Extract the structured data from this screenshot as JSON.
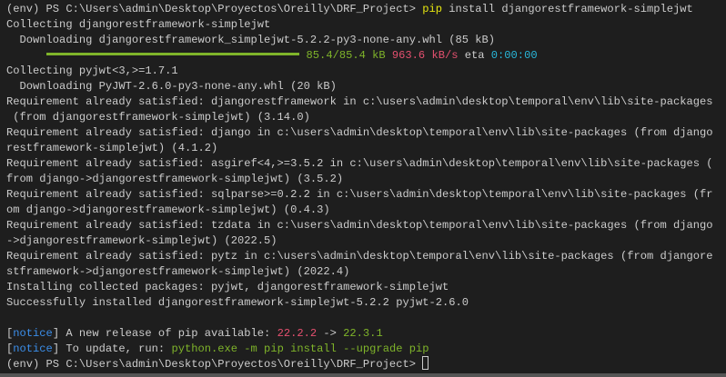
{
  "terminal": {
    "lines": [
      [
        {
          "t": "(env) PS C:\\Users\\admin\\Desktop\\Proyectos\\Oreilly\\DRF_Project> ",
          "c": "default"
        },
        {
          "t": "pip",
          "c": "yellow"
        },
        {
          "t": " install djangorestframework-simplejwt",
          "c": "default"
        }
      ],
      [
        {
          "t": "Collecting djangorestframework-simplejwt",
          "c": "default"
        }
      ],
      [
        {
          "t": "  Downloading djangorestframework_simplejwt-5.2.2-py3-none-any.whl (85 kB)",
          "c": "default"
        }
      ],
      [
        {
          "t": "      ",
          "c": "default"
        },
        {
          "t": "",
          "c": "bar"
        },
        {
          "t": "85.4/85.4 kB",
          "c": "green"
        },
        {
          "t": " ",
          "c": "default"
        },
        {
          "t": "963.6 kB/s",
          "c": "red"
        },
        {
          "t": " eta ",
          "c": "default"
        },
        {
          "t": "0:00:00",
          "c": "cyan"
        }
      ],
      [
        {
          "t": "Collecting pyjwt<3,>=1.7.1",
          "c": "default"
        }
      ],
      [
        {
          "t": "  Downloading PyJWT-2.6.0-py3-none-any.whl (20 kB)",
          "c": "default"
        }
      ],
      [
        {
          "t": "Requirement already satisfied: djangorestframework in c:\\users\\admin\\desktop\\temporal\\env\\lib\\site-packages",
          "c": "default"
        }
      ],
      [
        {
          "t": " (from djangorestframework-simplejwt) (3.14.0)",
          "c": "default"
        }
      ],
      [
        {
          "t": "Requirement already satisfied: django in c:\\users\\admin\\desktop\\temporal\\env\\lib\\site-packages (from django",
          "c": "default"
        }
      ],
      [
        {
          "t": "restframework-simplejwt) (4.1.2)",
          "c": "default"
        }
      ],
      [
        {
          "t": "Requirement already satisfied: asgiref<4,>=3.5.2 in c:\\users\\admin\\desktop\\temporal\\env\\lib\\site-packages (",
          "c": "default"
        }
      ],
      [
        {
          "t": "from django->djangorestframework-simplejwt) (3.5.2)",
          "c": "default"
        }
      ],
      [
        {
          "t": "Requirement already satisfied: sqlparse>=0.2.2 in c:\\users\\admin\\desktop\\temporal\\env\\lib\\site-packages (fr",
          "c": "default"
        }
      ],
      [
        {
          "t": "om django->djangorestframework-simplejwt) (0.4.3)",
          "c": "default"
        }
      ],
      [
        {
          "t": "Requirement already satisfied: tzdata in c:\\users\\admin\\desktop\\temporal\\env\\lib\\site-packages (from django",
          "c": "default"
        }
      ],
      [
        {
          "t": "->djangorestframework-simplejwt) (2022.5)",
          "c": "default"
        }
      ],
      [
        {
          "t": "Requirement already satisfied: pytz in c:\\users\\admin\\desktop\\temporal\\env\\lib\\site-packages (from djangore",
          "c": "default"
        }
      ],
      [
        {
          "t": "stframework->djangorestframework-simplejwt) (2022.4)",
          "c": "default"
        }
      ],
      [
        {
          "t": "Installing collected packages: pyjwt, djangorestframework-simplejwt",
          "c": "default"
        }
      ],
      [
        {
          "t": "Successfully installed djangorestframework-simplejwt-5.2.2 pyjwt-2.6.0",
          "c": "default"
        }
      ],
      [
        {
          "t": "",
          "c": "default"
        }
      ],
      [
        {
          "t": "[",
          "c": "default"
        },
        {
          "t": "notice",
          "c": "blue"
        },
        {
          "t": "] A new release of pip available: ",
          "c": "default"
        },
        {
          "t": "22.2.2",
          "c": "red"
        },
        {
          "t": " -> ",
          "c": "default"
        },
        {
          "t": "22.3.1",
          "c": "green"
        }
      ],
      [
        {
          "t": "[",
          "c": "default"
        },
        {
          "t": "notice",
          "c": "blue"
        },
        {
          "t": "] To update, run: ",
          "c": "default"
        },
        {
          "t": "python.exe -m pip install --upgrade pip",
          "c": "green"
        }
      ],
      [
        {
          "t": "(env) PS C:\\Users\\admin\\Desktop\\Proyectos\\Oreilly\\DRF_Project> ",
          "c": "default"
        },
        {
          "t": "",
          "c": "cursor"
        }
      ]
    ],
    "download_progress": 1.0,
    "colors": {
      "background": "#1e1e1e",
      "text": "#cccccc",
      "green": "#7fb42a",
      "red": "#e4506f",
      "cyan": "#29b8db",
      "blue": "#3b8eea",
      "yellow": "#e5e510"
    }
  }
}
